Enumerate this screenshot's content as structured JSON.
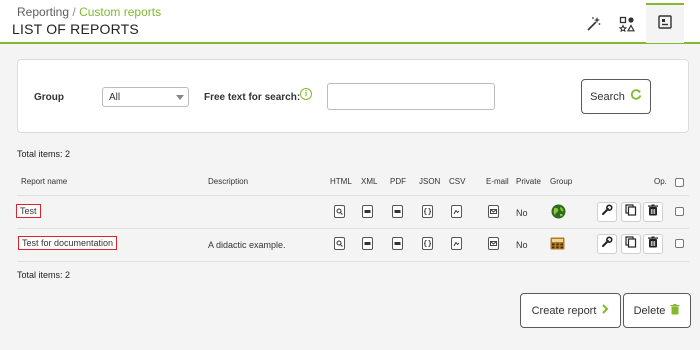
{
  "breadcrumb": {
    "root": "Reporting",
    "separator": "/",
    "current": "Custom reports"
  },
  "page_title": "LIST OF REPORTS",
  "header_icons": [
    "wizard-icon",
    "shapes-icon",
    "report-list-icon"
  ],
  "filter": {
    "group_label": "Group",
    "group_value": "All",
    "search_label": "Free text for search:",
    "search_value": "",
    "search_button": "Search"
  },
  "total_top": "Total items: 2",
  "total_bottom": "Total items: 2",
  "columns": {
    "name": "Report name",
    "description": "Description",
    "html": "HTML",
    "xml": "XML",
    "pdf": "PDF",
    "json": "JSON",
    "csv": "CSV",
    "email": "E-mail",
    "private": "Private",
    "group": "Group",
    "op": "Op."
  },
  "rows": [
    {
      "name": "Test",
      "description": "",
      "private": "No",
      "group_icon": "globe-icon"
    },
    {
      "name": "Test for documentation",
      "description": "A didactic example.",
      "private": "No",
      "group_icon": "calculator-icon"
    }
  ],
  "buttons": {
    "create": "Create report",
    "delete": "Delete"
  },
  "colors": {
    "accent": "#82b92e",
    "highlight": "#d9252b"
  }
}
